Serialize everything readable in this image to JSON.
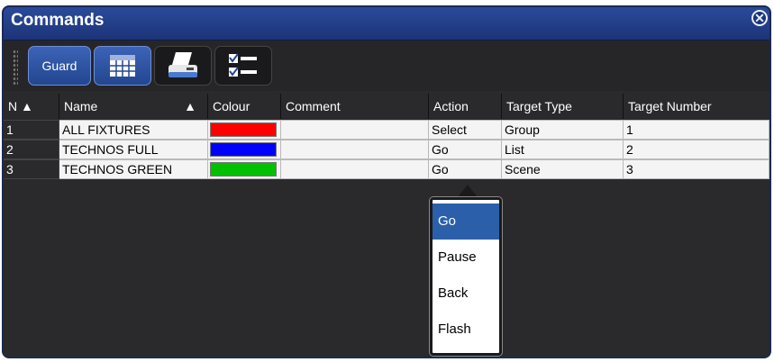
{
  "window": {
    "title": "Commands"
  },
  "toolbar": {
    "guard_label": "Guard"
  },
  "table": {
    "headers": {
      "n": "N ▲",
      "name": "Name",
      "name_sort": "▲",
      "colour": "Colour",
      "comment": "Comment",
      "action": "Action",
      "target_type": "Target Type",
      "target_number": "Target Number"
    },
    "rows": [
      {
        "n": "1",
        "name": "ALL FIXTURES",
        "colour": "#ff0000",
        "comment": "",
        "action": "Select",
        "target_type": "Group",
        "target_number": "1"
      },
      {
        "n": "2",
        "name": "TECHNOS FULL",
        "colour": "#0000ff",
        "comment": "",
        "action": "Go",
        "target_type": "List",
        "target_number": "2"
      },
      {
        "n": "3",
        "name": "TECHNOS GREEN",
        "colour": "#00c000",
        "comment": "",
        "action": "Go",
        "target_type": "Scene",
        "target_number": "3"
      }
    ]
  },
  "dropdown": {
    "options": [
      "Go",
      "Pause",
      "Back",
      "Flash"
    ],
    "selected": "Go"
  },
  "colors": {
    "title_bar": "#1c3478",
    "accent": "#2b5faa",
    "background": "#2a2a2c"
  },
  "icons": [
    "close-icon",
    "grid-view-icon",
    "print-icon",
    "checklist-icon",
    "sort-asc-icon"
  ]
}
